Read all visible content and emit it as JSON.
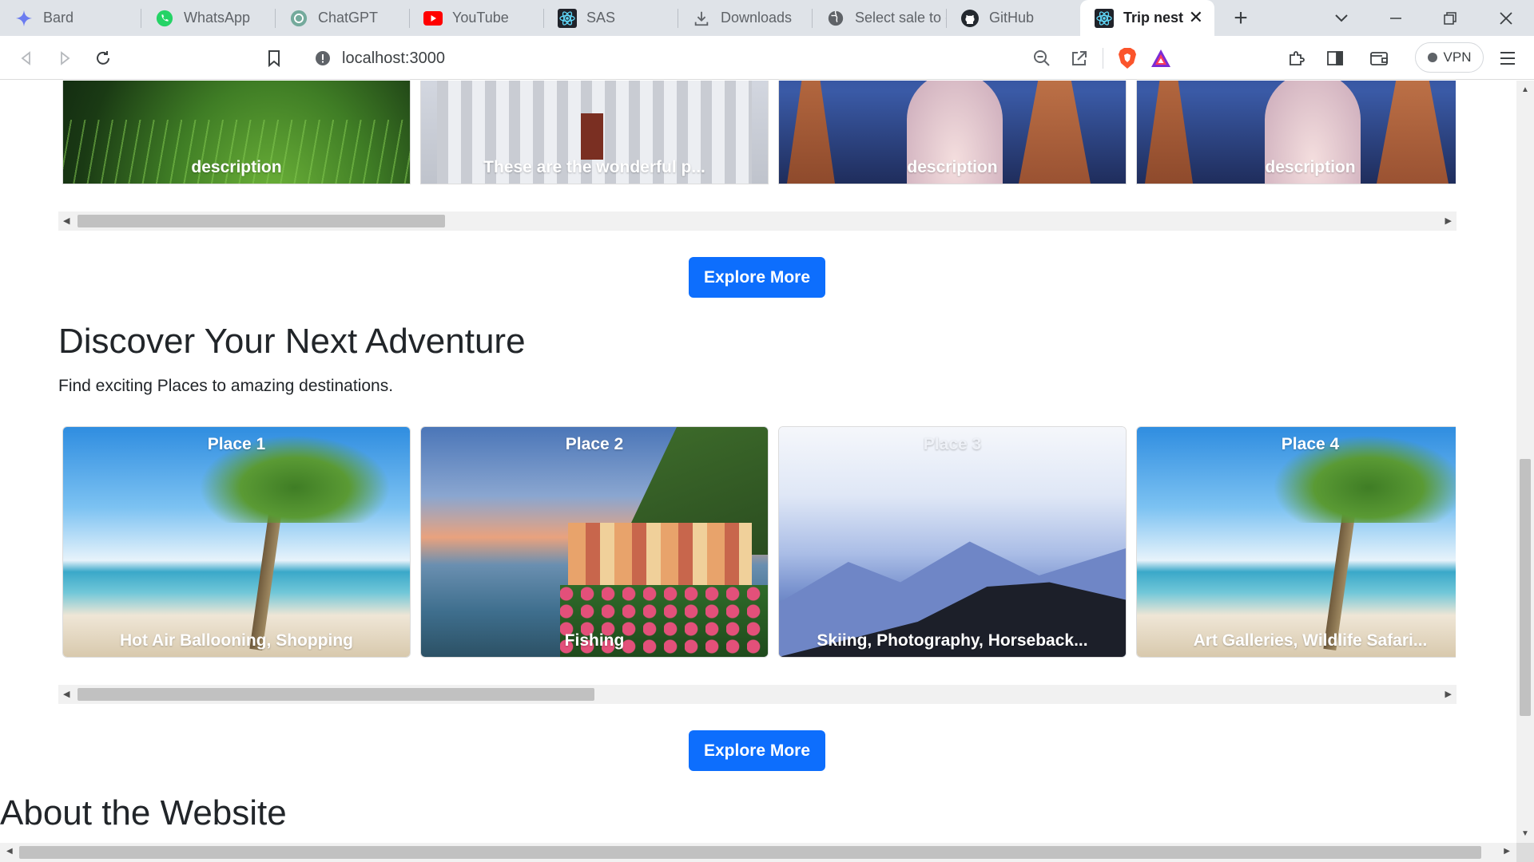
{
  "browser": {
    "tabs": [
      {
        "title": "Bard",
        "icon": "bard-icon"
      },
      {
        "title": "WhatsApp",
        "icon": "whatsapp-icon"
      },
      {
        "title": "ChatGPT",
        "icon": "chatgpt-icon"
      },
      {
        "title": "YouTube",
        "icon": "youtube-icon"
      },
      {
        "title": "SAS",
        "icon": "react-icon"
      },
      {
        "title": "Downloads",
        "icon": "download-icon"
      },
      {
        "title": "Select sale to c",
        "icon": "globe-icon"
      },
      {
        "title": "GitHub",
        "icon": "github-icon"
      },
      {
        "title": "Trip nest",
        "icon": "react-icon",
        "active": true
      }
    ],
    "address": "localhost:3000",
    "vpn_label": "VPN",
    "accent": "#0d6efd"
  },
  "top_row": {
    "cards": [
      {
        "caption": "description"
      },
      {
        "caption": "These are the wonderful p..."
      },
      {
        "caption": "description"
      },
      {
        "caption": "description"
      }
    ],
    "scroll_fraction": 0.27
  },
  "explore_label": "Explore More",
  "adventure": {
    "heading": "Discover Your Next Adventure",
    "subtitle": "Find exciting Places to amazing destinations.",
    "cards": [
      {
        "title": "Place 1",
        "activities": "Hot Air Ballooning, Shopping"
      },
      {
        "title": "Place 2",
        "activities": "Fishing"
      },
      {
        "title": "Place 3",
        "activities": "Skiing, Photography, Horseback..."
      },
      {
        "title": "Place 4",
        "activities": "Art Galleries, Wildlife Safari..."
      }
    ],
    "scroll_fraction": 0.38
  },
  "about": {
    "heading": "About the Website"
  }
}
